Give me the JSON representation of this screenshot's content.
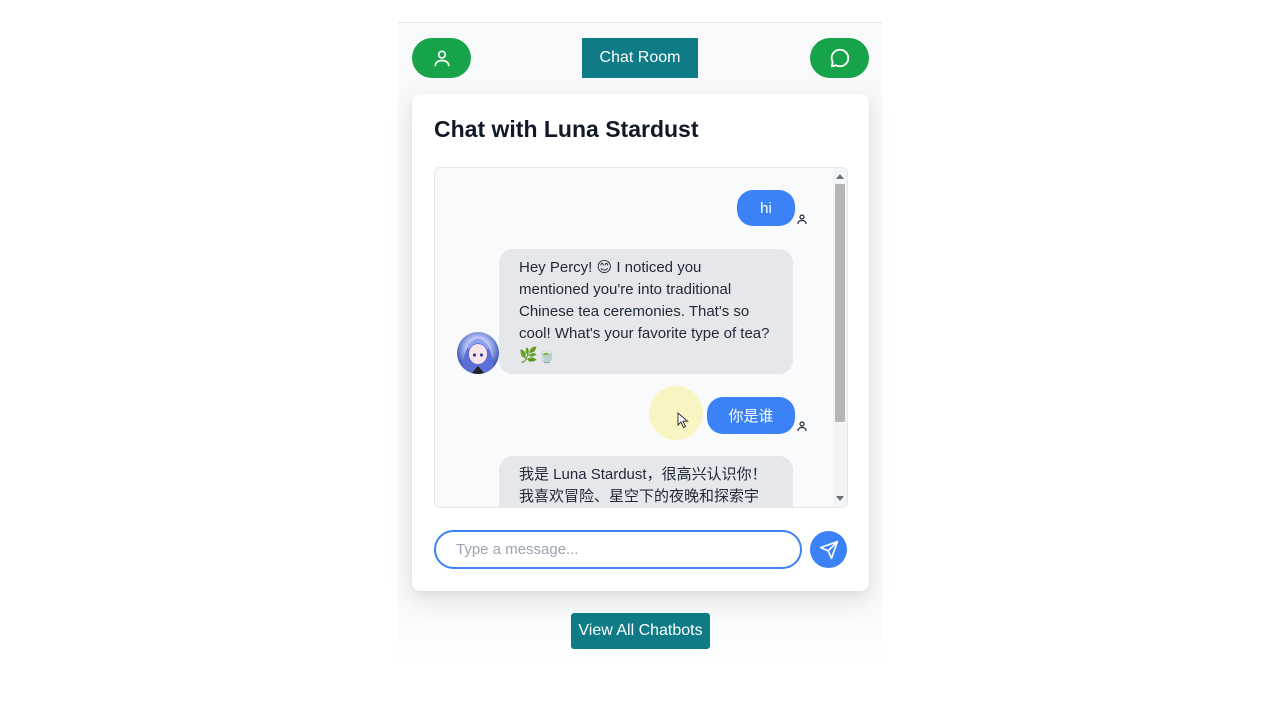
{
  "header": {
    "title_button": "Chat Room",
    "profile_icon": "user-icon",
    "chats_icon": "message-circle-icon"
  },
  "chat": {
    "heading": "Chat with Luna Stardust",
    "messages": [
      {
        "sender": "user",
        "text": "hi"
      },
      {
        "sender": "bot",
        "text": "Hey Percy! 😊 I noticed you mentioned you're into traditional Chinese tea ceremonies. That's so cool! What's your favorite type of tea? 🌿🍵"
      },
      {
        "sender": "user",
        "text": "你是谁"
      },
      {
        "sender": "bot",
        "text": "我是 Luna Stardust，很高兴认识你！我喜欢冒险、星空下的夜晚和探索宇宙"
      }
    ],
    "input_placeholder": "Type a message...",
    "send_icon": "send-icon"
  },
  "footer": {
    "view_all_label": "View All Chatbots"
  },
  "colors": {
    "green": "#16a34a",
    "teal": "#0e7b86",
    "blue": "#3b82f6",
    "bot_bubble": "#e5e7eb"
  }
}
